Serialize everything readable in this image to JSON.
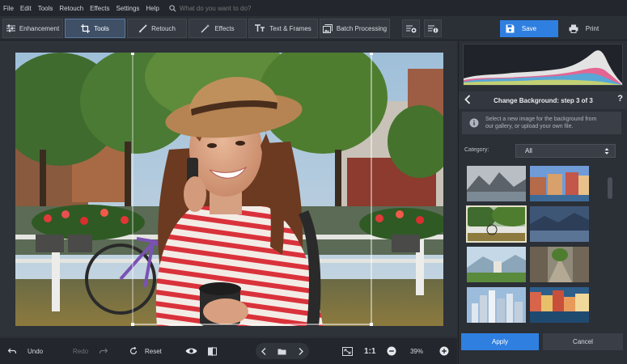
{
  "menu": {
    "items": [
      "File",
      "Edit",
      "Tools",
      "Retouch",
      "Effects",
      "Settings",
      "Help"
    ],
    "search_placeholder": "What do you want to do?"
  },
  "toolbar": {
    "tabs": [
      {
        "label": "Enhancement",
        "icon": "sliders-icon"
      },
      {
        "label": "Tools",
        "icon": "crop-icon",
        "active": true
      },
      {
        "label": "Retouch",
        "icon": "brush-icon"
      },
      {
        "label": "Effects",
        "icon": "magic-wand-icon"
      },
      {
        "label": "Text & Frames",
        "icon": "text-icon"
      },
      {
        "label": "Batch Processing",
        "icon": "images-icon"
      }
    ],
    "save_label": "Save",
    "print_label": "Print"
  },
  "bottom": {
    "undo_label": "Undo",
    "redo_label": "Redo",
    "reset_label": "Reset",
    "ratio_label": "1:1",
    "zoom_value": "39%"
  },
  "panel": {
    "step_title": "Change Background: step 3 of 3",
    "help_label": "?",
    "info_line1": "Select a new image for the background from",
    "info_line2": "our gallery, or upload your own file.",
    "category_label": "Category:",
    "category_value": "All",
    "apply_label": "Apply",
    "cancel_label": "Cancel"
  },
  "colors": {
    "accent": "#2f7fe0",
    "background": "#2b2f36",
    "menubar": "#23272d"
  }
}
